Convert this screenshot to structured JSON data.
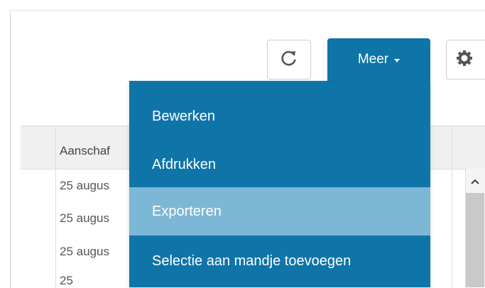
{
  "toolbar": {
    "refresh_icon": "refresh-icon",
    "more_label": "Meer",
    "settings_icon": "gear-icon"
  },
  "table": {
    "column_header": "Aanschaf",
    "rows": [
      "25 augus",
      "25 augus",
      "25 augus",
      "25"
    ]
  },
  "menu": {
    "items": [
      {
        "label": "Bewerken"
      },
      {
        "label": "Afdrukken"
      },
      {
        "label": "Exporteren",
        "highlighted": true
      },
      {
        "label": "Selectie aan mandje toevoegen"
      }
    ]
  },
  "colors": {
    "accent": "#0f75a8",
    "menu_hover": "#7db7d6"
  }
}
